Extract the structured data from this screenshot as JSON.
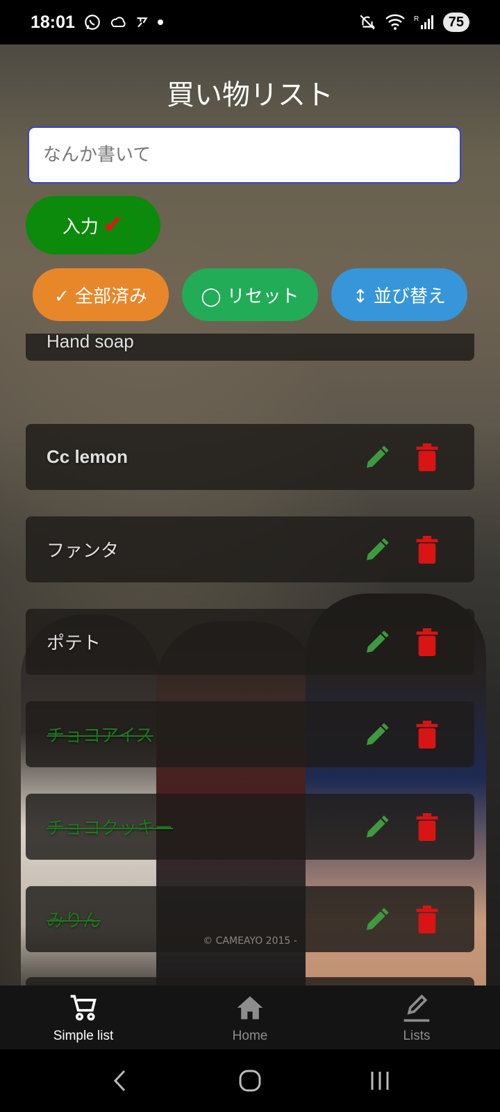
{
  "status_bar": {
    "time": "18:01",
    "battery": "75"
  },
  "app": {
    "title": "買い物リスト",
    "input_placeholder": "なんか書いて",
    "enter_button": "入力",
    "actions": {
      "complete_all": "✓ 全部済み",
      "reset": "◯ リセット",
      "sort": "↕ 並び替え"
    },
    "items": [
      {
        "label": "Hand soap",
        "done": false
      },
      {
        "label": "Cc lemon",
        "done": false
      },
      {
        "label": "ファンタ",
        "done": false
      },
      {
        "label": "ポテト",
        "done": false
      },
      {
        "label": "チョコアイス",
        "done": true
      },
      {
        "label": "チョコクッキー",
        "done": true
      },
      {
        "label": "みりん",
        "done": true
      }
    ],
    "copyright": "© CAMEAYO 2015 -"
  },
  "bottom_nav": {
    "items": [
      {
        "label": "Simple list",
        "icon": "cart-icon",
        "active": true
      },
      {
        "label": "Home",
        "icon": "home-icon",
        "active": false
      },
      {
        "label": "Lists",
        "icon": "pencil-icon",
        "active": false
      }
    ]
  },
  "colors": {
    "enter": "#0b8a0b",
    "complete_all": "#e8872a",
    "reset": "#22ac58",
    "sort": "#3696d9",
    "edit": "#3f9a3f",
    "delete": "#d81414",
    "done_text": "#1f7a1f"
  }
}
